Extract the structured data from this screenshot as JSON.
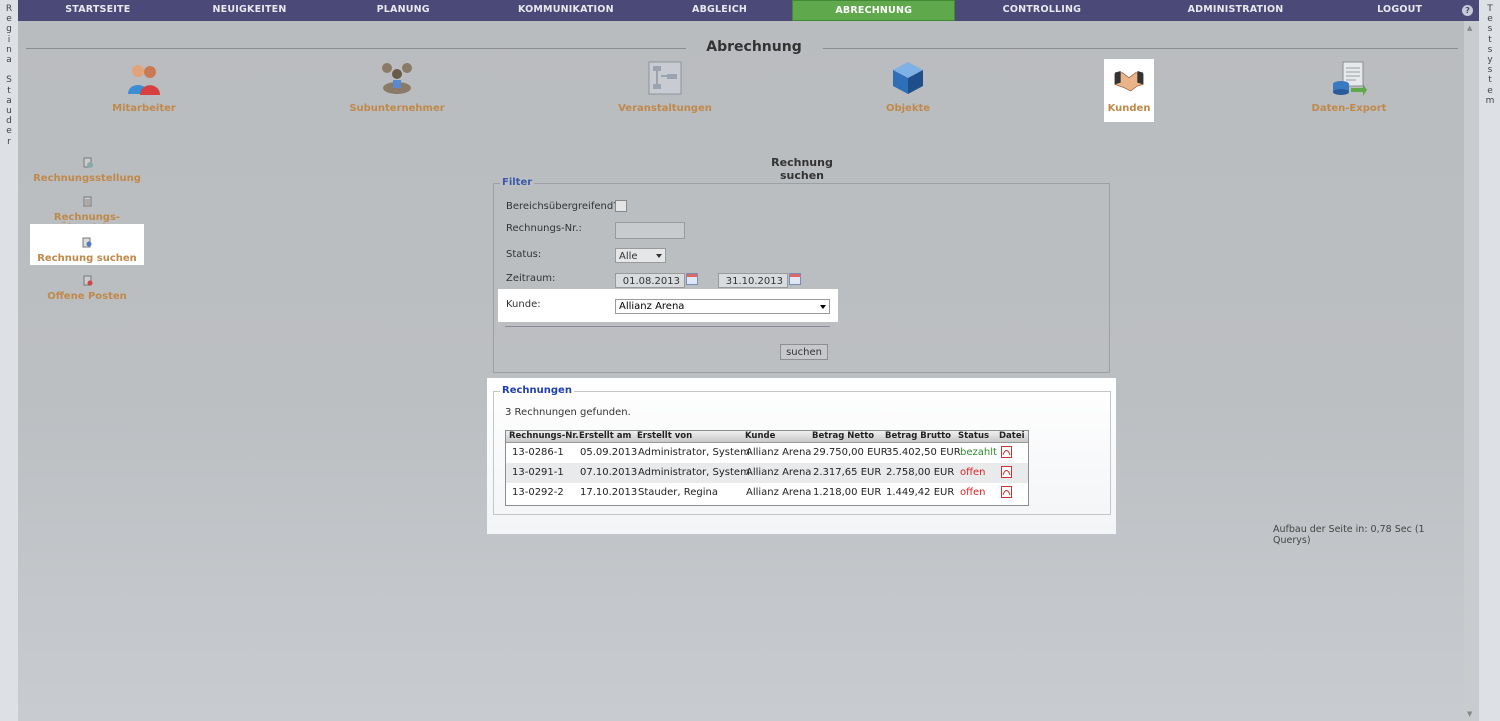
{
  "left_strip": [
    "R",
    "e",
    "g",
    "i",
    "n",
    "a",
    " ",
    "S",
    "t",
    "a",
    "u",
    "d",
    "e",
    "r"
  ],
  "right_strip": [
    "T",
    "e",
    "s",
    "t",
    "s",
    "y",
    "s",
    "t",
    "e",
    "m"
  ],
  "nav": [
    {
      "label": "STARTSEITE"
    },
    {
      "label": "NEUIGKEITEN"
    },
    {
      "label": "PLANUNG"
    },
    {
      "label": "KOMMUNIKATION"
    },
    {
      "label": "ABGLEICH"
    },
    {
      "label": "ABRECHNUNG",
      "active": true
    },
    {
      "label": "CONTROLLING"
    },
    {
      "label": "ADMINISTRATION"
    },
    {
      "label": "LOGOUT"
    }
  ],
  "help_icon": "?",
  "section_title": "Abrechnung",
  "modules": [
    {
      "label": "Mitarbeiter",
      "icon": "people-icon"
    },
    {
      "label": "Subunternehmer",
      "icon": "group-icon"
    },
    {
      "label": "Veranstaltungen",
      "icon": "flowchart-icon"
    },
    {
      "label": "Objekte",
      "icon": "cube-icon"
    },
    {
      "label": "Kunden",
      "icon": "handshake-icon",
      "selected": true
    },
    {
      "label": "Daten-Export",
      "icon": "export-icon"
    }
  ],
  "subnav": [
    {
      "label": "Rechnungsstellung"
    },
    {
      "label": "Rechnungs-Übersicht"
    },
    {
      "label": "Rechnung suchen",
      "selected": true
    },
    {
      "label": "Offene Posten"
    }
  ],
  "page_title": "Rechnung suchen",
  "filter": {
    "legend": "Filter",
    "bereich_label": "Bereichsübergreifend?",
    "rnr_label": "Rechnungs-Nr.:",
    "status_label": "Status:",
    "status_value": "Alle",
    "zeitraum_label": "Zeitraum:",
    "date_from": "01.08.2013",
    "date_to": "31.10.2013",
    "kunde_label": "Kunde:",
    "kunde_value": "Allianz Arena",
    "search_button": "suchen"
  },
  "results": {
    "legend": "Rechnungen",
    "count_text": "3 Rechnungen gefunden.",
    "columns": [
      "Rechnungs-Nr.",
      "Erstellt am",
      "Erstellt von",
      "Kunde",
      "Betrag Netto",
      "Betrag Brutto",
      "Status",
      "Datei"
    ],
    "rows": [
      {
        "nr": "13-0286-1",
        "date": "05.09.2013",
        "by": "Administrator, System",
        "kunde": "Allianz Arena",
        "netto": "29.750,00 EUR",
        "brutto": "35.402,50 EUR",
        "status": "bezahlt"
      },
      {
        "nr": "13-0291-1",
        "date": "07.10.2013",
        "by": "Administrator, System",
        "kunde": "Allianz Arena",
        "netto": "2.317,65 EUR",
        "brutto": "2.758,00 EUR",
        "status": "offen"
      },
      {
        "nr": "13-0292-2",
        "date": "17.10.2013",
        "by": "Stauder, Regina",
        "kunde": "Allianz Arena",
        "netto": "1.218,00 EUR",
        "brutto": "1.449,42 EUR",
        "status": "offen"
      }
    ]
  },
  "footer_text": "Aufbau der Seite in: 0,78 Sec (1 Querys)",
  "colors": {
    "nav_bg": "#4a4978",
    "nav_active": "#5fa84c",
    "link": "#c0894a",
    "legend": "#3d5aa8",
    "status_paid": "#2e8b2e",
    "status_open": "#dd2222"
  }
}
